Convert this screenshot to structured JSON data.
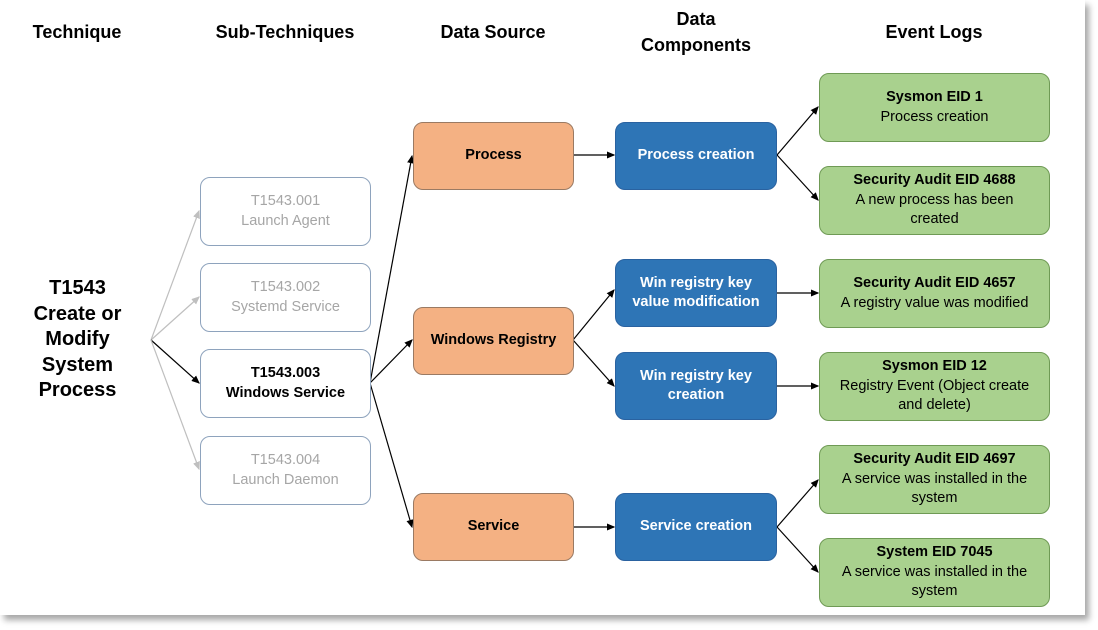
{
  "headers": {
    "technique": "Technique",
    "sub_techniques": "Sub-Techniques",
    "data_source": "Data Source",
    "data_components_line1": "Data",
    "data_components_line2": "Components",
    "event_logs": "Event Logs"
  },
  "technique": {
    "id": "T1543",
    "name_lines": [
      "Create or",
      "Modify",
      "System",
      "Process"
    ]
  },
  "sub_techniques": [
    {
      "id": "T1543.001",
      "name": "Launch Agent",
      "active": false
    },
    {
      "id": "T1543.002",
      "name": "Systemd Service",
      "active": false
    },
    {
      "id": "T1543.003",
      "name": "Windows Service",
      "active": true
    },
    {
      "id": "T1543.004",
      "name": "Launch Daemon",
      "active": false
    }
  ],
  "data_sources": [
    {
      "label": "Process"
    },
    {
      "label": "Windows Registry"
    },
    {
      "label": "Service"
    }
  ],
  "data_components": [
    {
      "lines": [
        "Process creation"
      ]
    },
    {
      "lines": [
        "Win registry key",
        "value modification"
      ]
    },
    {
      "lines": [
        "Win registry key",
        "creation"
      ]
    },
    {
      "lines": [
        "Service creation"
      ]
    }
  ],
  "event_logs": [
    {
      "title": "Sysmon EID 1",
      "lines": [
        "Process creation"
      ]
    },
    {
      "title": "Security Audit EID 4688",
      "lines": [
        "A new process has been",
        "created"
      ]
    },
    {
      "title": "Security Audit EID 4657",
      "lines": [
        "A registry value was modified"
      ]
    },
    {
      "title": "Sysmon EID 12",
      "lines": [
        "Registry Event (Object create",
        "and delete)"
      ]
    },
    {
      "title": "Security Audit EID 4697",
      "lines": [
        "A service was installed in the",
        "system"
      ]
    },
    {
      "title": "System EID 7045",
      "lines": [
        "A service was installed in the",
        "system"
      ]
    }
  ],
  "colors": {
    "data_source_fill": "#f4b183",
    "data_component_fill": "#2e75b6",
    "event_log_fill": "#a9d18e",
    "inactive_text": "#a6a6a6",
    "inactive_connector": "#bfbfbf"
  }
}
